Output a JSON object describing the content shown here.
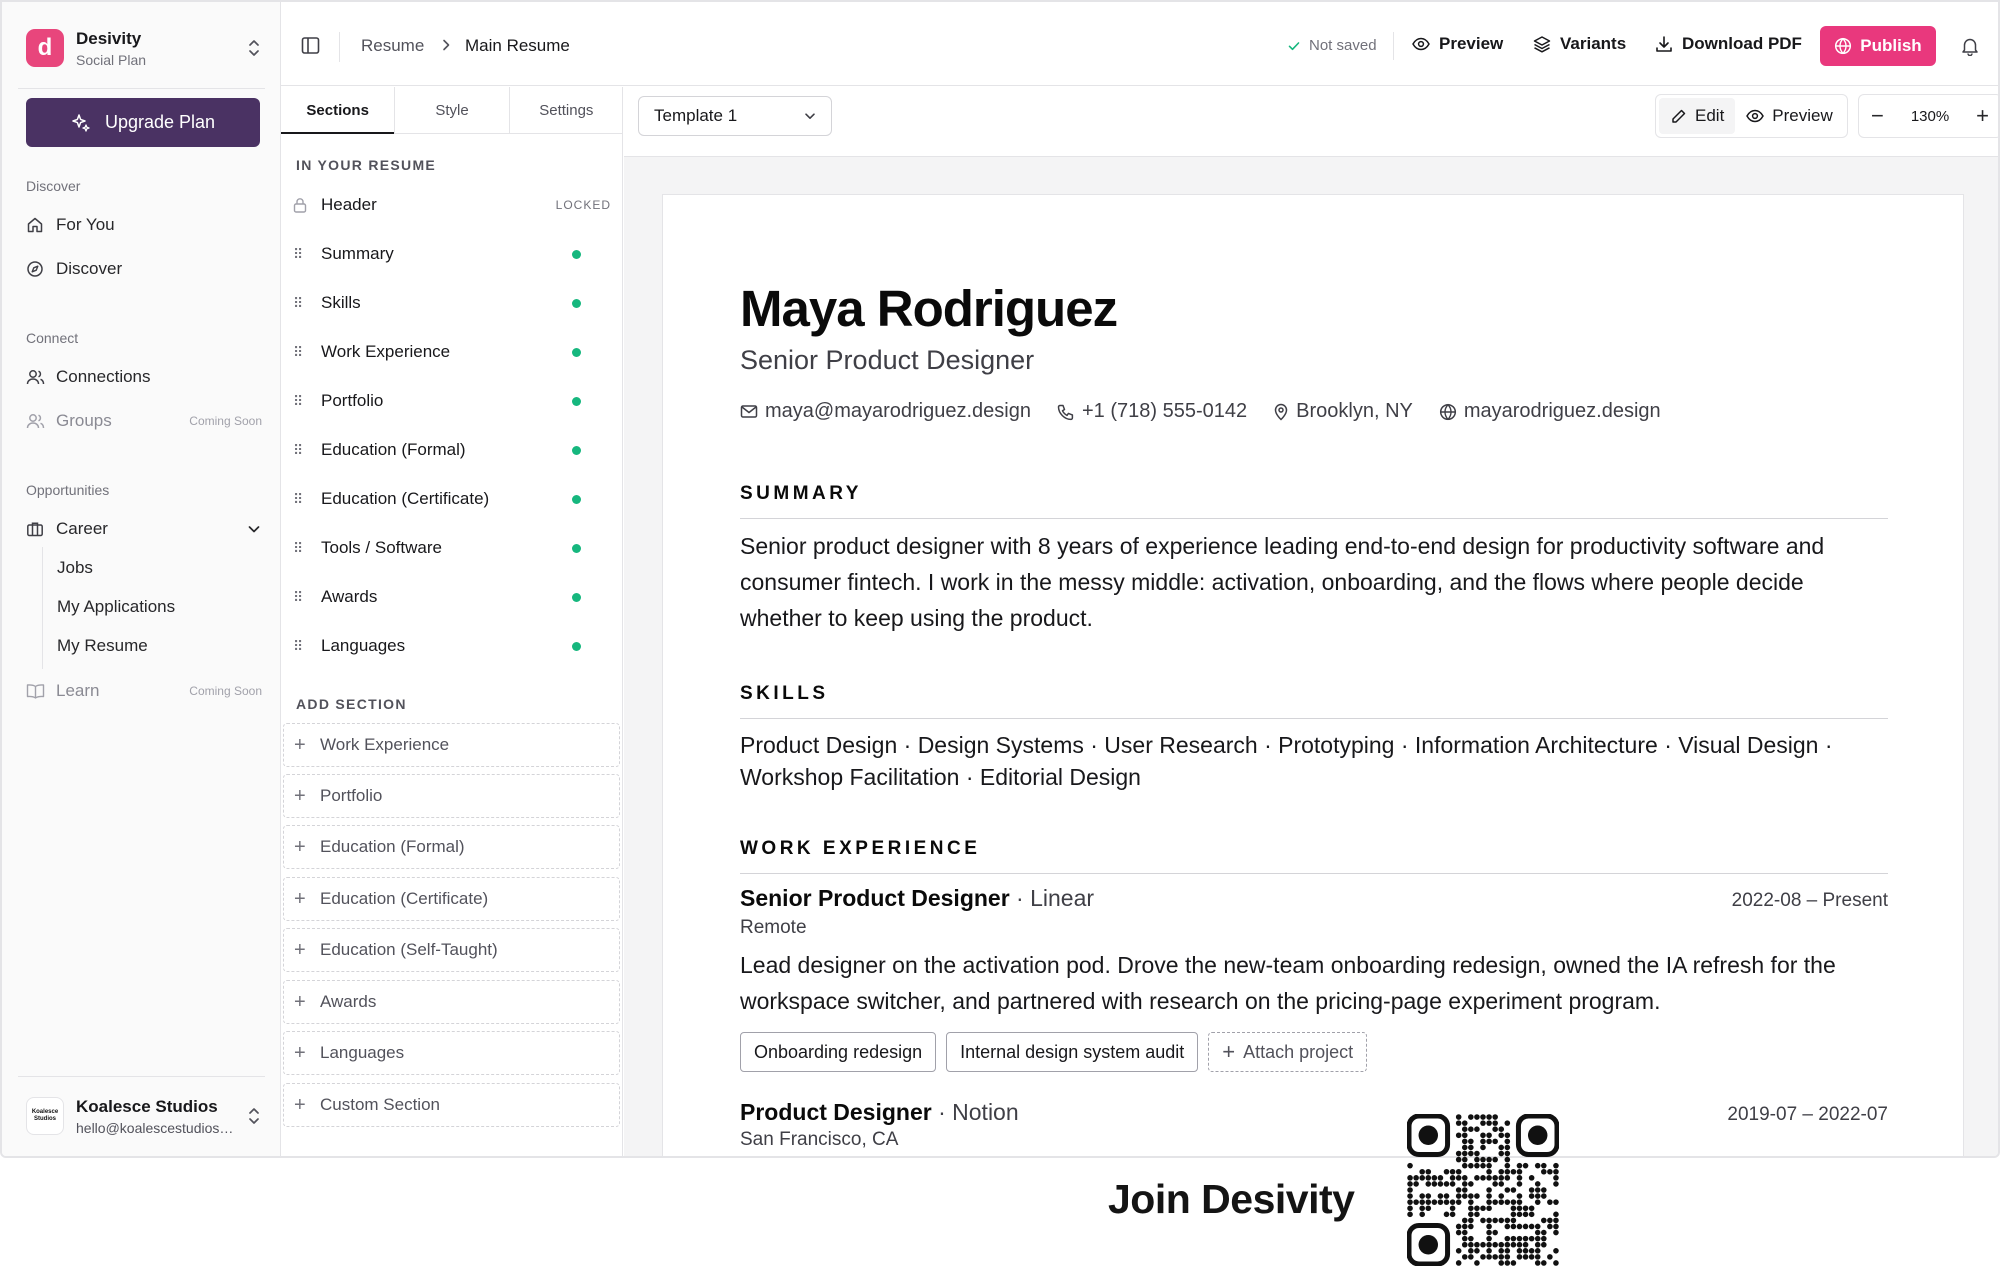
{
  "workspace": {
    "initial": "d",
    "name": "Desivity",
    "plan": "Social Plan"
  },
  "upgrade_label": "Upgrade Plan",
  "nav": {
    "discover_heading": "Discover",
    "for_you": "For You",
    "discover": "Discover",
    "connect_heading": "Connect",
    "connections": "Connections",
    "groups": "Groups",
    "groups_badge": "Coming Soon",
    "opportunities_heading": "Opportunities",
    "career": "Career",
    "jobs": "Jobs",
    "my_applications": "My Applications",
    "my_resume": "My Resume",
    "learn": "Learn",
    "learn_badge": "Coming Soon"
  },
  "account": {
    "logo_text": "Koalesce Studios",
    "name": "Koalesce Studios",
    "email": "hello@koalescestudios.com"
  },
  "topbar": {
    "breadcrumb_root": "Resume",
    "breadcrumb_current": "Main Resume",
    "status": "Not saved",
    "preview": "Preview",
    "variants": "Variants",
    "download": "Download PDF",
    "publish": "Publish"
  },
  "panel": {
    "tabs": [
      "Sections",
      "Style",
      "Settings"
    ],
    "in_resume_heading": "IN YOUR RESUME",
    "header_label": "Header",
    "locked_label": "LOCKED",
    "sections": [
      "Summary",
      "Skills",
      "Work Experience",
      "Portfolio",
      "Education (Formal)",
      "Education (Certificate)",
      "Tools / Software",
      "Awards",
      "Languages"
    ],
    "add_heading": "ADD SECTION",
    "add_sections": [
      "Work Experience",
      "Portfolio",
      "Education (Formal)",
      "Education (Certificate)",
      "Education (Self-Taught)",
      "Awards",
      "Languages",
      "Custom Section"
    ]
  },
  "toolbar": {
    "template": "Template 1",
    "edit": "Edit",
    "preview": "Preview",
    "zoom": "130%"
  },
  "resume": {
    "name": "Maya Rodriguez",
    "title": "Senior Product Designer",
    "email": "maya@mayarodriguez.design",
    "phone": "+1 (718) 555-0142",
    "location": "Brooklyn, NY",
    "website": "mayarodriguez.design",
    "summary_heading": "SUMMARY",
    "summary": "Senior product designer with 8 years of experience leading end-to-end design for productivity software and consumer fintech. I work in the messy middle: activation, onboarding, and the flows where people decide whether to keep using the product.",
    "skills_heading": "SKILLS",
    "skills": "Product Design · Design Systems · User Research · Prototyping · Information Architecture · Visual Design · Workshop Facilitation · Editorial Design",
    "experience_heading": "WORK EXPERIENCE",
    "jobs": [
      {
        "role": "Senior Product Designer",
        "company": " · Linear",
        "dates": "2022-08 – Present",
        "location": "Remote",
        "description": "Lead designer on the activation pod. Drove the new-team onboarding redesign, owned the IA refresh for the workspace switcher, and partnered with research on the pricing-page experiment program.",
        "projects": [
          "Onboarding redesign",
          "Internal design system audit"
        ],
        "attach_label": "Attach project"
      },
      {
        "role": "Product Designer",
        "company": " · Notion",
        "dates": "2019-07 – 2022-07",
        "location": "San Francisco, CA"
      }
    ]
  },
  "promo": {
    "text": "Join Desivity"
  },
  "colors": {
    "brand": "#e8467c",
    "publish": "#e9387d",
    "upgrade": "#4a3263",
    "status_dot": "#16b77e"
  }
}
